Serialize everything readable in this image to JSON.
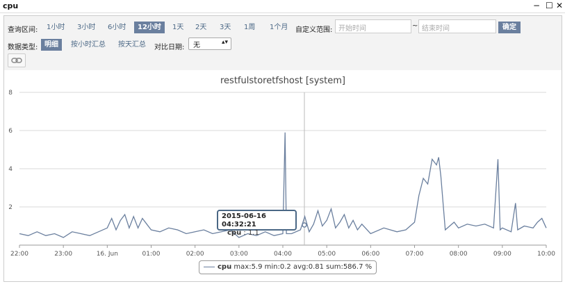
{
  "window": {
    "title": "cpu",
    "minimize_icon": "−",
    "maximize_icon": "☐",
    "close_icon": "✕"
  },
  "toolbar": {
    "range_label": "查询区间:",
    "ranges": [
      "1小时",
      "3小时",
      "6小时",
      "12小时",
      "1天",
      "2天",
      "3天",
      "1周",
      "1个月"
    ],
    "active_range": "12小时",
    "custom_label": "自定义范围:",
    "start_placeholder": "开始时间",
    "sep": "~",
    "end_placeholder": "结束时间",
    "ok_label": "确定",
    "type_label": "数据类型:",
    "types": [
      "明细",
      "按小时汇总",
      "按天汇总"
    ],
    "active_type": "明细",
    "compare_label": "对比日期:",
    "compare_value": "无",
    "link_icon": "link-icon"
  },
  "chart_data": {
    "type": "line",
    "title": "restfulstoretfshost [system]",
    "x_ticks": [
      "22:00",
      "23:00",
      "16. Jun",
      "01:00",
      "02:00",
      "03:00",
      "04:00",
      "05:00",
      "06:00",
      "07:00",
      "08:00",
      "09:00",
      "10:00"
    ],
    "y_ticks": [
      2,
      4,
      6,
      8
    ],
    "ylim": [
      0,
      8
    ],
    "series": [
      {
        "name": "cpu",
        "color": "#6a7f9e",
        "points": [
          [
            0,
            0.6
          ],
          [
            0.2,
            0.5
          ],
          [
            0.4,
            0.7
          ],
          [
            0.6,
            0.5
          ],
          [
            0.8,
            0.6
          ],
          [
            1,
            0.4
          ],
          [
            1.2,
            0.7
          ],
          [
            1.4,
            0.6
          ],
          [
            1.6,
            0.5
          ],
          [
            1.8,
            0.7
          ],
          [
            2,
            0.9
          ],
          [
            2.1,
            1.4
          ],
          [
            2.2,
            0.8
          ],
          [
            2.3,
            1.3
          ],
          [
            2.4,
            1.6
          ],
          [
            2.5,
            0.9
          ],
          [
            2.6,
            1.5
          ],
          [
            2.7,
            0.9
          ],
          [
            2.8,
            1.4
          ],
          [
            2.9,
            1.1
          ],
          [
            3,
            0.8
          ],
          [
            3.2,
            0.7
          ],
          [
            3.4,
            0.9
          ],
          [
            3.6,
            0.8
          ],
          [
            3.8,
            0.6
          ],
          [
            4,
            0.7
          ],
          [
            4.2,
            0.8
          ],
          [
            4.4,
            0.6
          ],
          [
            4.6,
            0.7
          ],
          [
            4.8,
            0.8
          ],
          [
            5,
            0.4
          ],
          [
            5.2,
            0.6
          ],
          [
            5.4,
            0.5
          ],
          [
            5.6,
            0.7
          ],
          [
            5.8,
            0.5
          ],
          [
            6,
            0.6
          ],
          [
            6.05,
            5.9
          ],
          [
            6.08,
            0.6
          ],
          [
            6.2,
            0.6
          ],
          [
            6.4,
            0.8
          ],
          [
            6.5,
            1.5
          ],
          [
            6.6,
            0.7
          ],
          [
            6.7,
            1.1
          ],
          [
            6.8,
            1.8
          ],
          [
            6.9,
            1.0
          ],
          [
            7,
            1.3
          ],
          [
            7.1,
            1.9
          ],
          [
            7.2,
            0.9
          ],
          [
            7.3,
            1.2
          ],
          [
            7.4,
            1.6
          ],
          [
            7.5,
            0.9
          ],
          [
            7.6,
            1.3
          ],
          [
            7.7,
            0.8
          ],
          [
            7.8,
            1.1
          ],
          [
            8,
            0.6
          ],
          [
            8.3,
            0.9
          ],
          [
            8.6,
            0.7
          ],
          [
            8.8,
            0.8
          ],
          [
            9,
            1.2
          ],
          [
            9.1,
            2.6
          ],
          [
            9.2,
            3.5
          ],
          [
            9.3,
            3.2
          ],
          [
            9.4,
            4.5
          ],
          [
            9.5,
            4.2
          ],
          [
            9.55,
            4.6
          ],
          [
            9.6,
            3.6
          ],
          [
            9.7,
            0.8
          ],
          [
            9.9,
            1.2
          ],
          [
            10,
            0.9
          ],
          [
            10.2,
            1.1
          ],
          [
            10.4,
            1.0
          ],
          [
            10.6,
            1.1
          ],
          [
            10.8,
            0.9
          ],
          [
            10.9,
            4.5
          ],
          [
            10.95,
            0.8
          ],
          [
            11,
            0.9
          ],
          [
            11.2,
            0.7
          ],
          [
            11.3,
            2.2
          ],
          [
            11.35,
            0.8
          ],
          [
            11.5,
            1.0
          ],
          [
            11.7,
            0.9
          ],
          [
            11.8,
            1.2
          ],
          [
            11.9,
            1.4
          ],
          [
            12,
            0.9
          ]
        ]
      }
    ]
  },
  "tooltip": {
    "date": "2015-06-16 04:32:21",
    "series": "cpu",
    "value": ": 1.1"
  },
  "legend": {
    "series": "cpu",
    "stats": "max:5.9 min:0.2 avg:0.81 sum:586.7 %"
  }
}
